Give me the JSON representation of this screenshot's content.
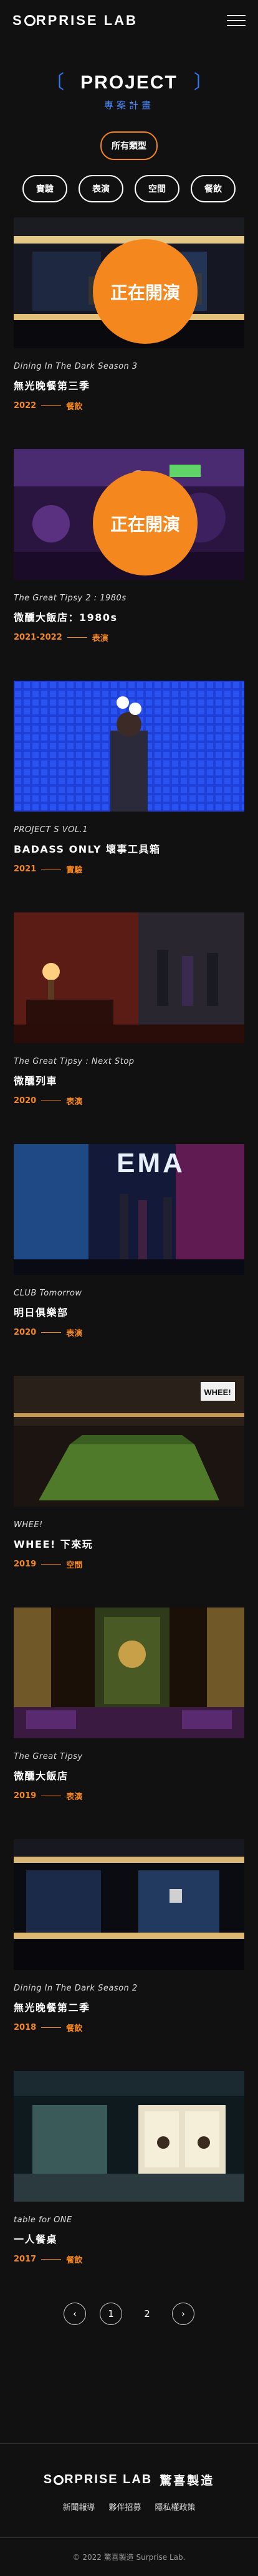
{
  "header": {
    "logo_pre": "S",
    "logo_post": "RPRISE LAB"
  },
  "heading": {
    "title": "PROJECT",
    "subtitle": "專案計畫",
    "bracket_left": "〔",
    "bracket_right": "〕"
  },
  "filters": {
    "all": "所有類型",
    "types": [
      "實驗",
      "表演",
      "空間",
      "餐飲"
    ]
  },
  "projects": [
    {
      "en": "Dining In The Dark Season 3",
      "zh": "無光晚餐第三季",
      "year": "2022",
      "type": "餐飲",
      "badge": "正在開演"
    },
    {
      "en": "The Great Tipsy 2 : 1980s",
      "zh": "微醺大飯店：1980s",
      "year": "2021-2022",
      "type": "表演",
      "badge": "正在開演"
    },
    {
      "en": "PROJECT S VOL.1",
      "zh": "BADASS ONLY 壞事工具箱",
      "year": "2021",
      "type": "實驗"
    },
    {
      "en": "The Great Tipsy : Next Stop",
      "zh": "微醺列車",
      "year": "2020",
      "type": "表演"
    },
    {
      "en": "CLUB Tomorrow",
      "zh": "明日俱樂部",
      "year": "2020",
      "type": "表演",
      "sign": "EMA"
    },
    {
      "en": "WHEE!",
      "zh": "WHEE! 下來玩",
      "year": "2019",
      "type": "空間",
      "sign": "WHEE!"
    },
    {
      "en": "The Great Tipsy",
      "zh": "微醺大飯店",
      "year": "2019",
      "type": "表演"
    },
    {
      "en": "Dining In The Dark Season 2",
      "zh": "無光晚餐第二季",
      "year": "2018",
      "type": "餐飲"
    },
    {
      "en": "table for ONE",
      "zh": "一人餐桌",
      "year": "2017",
      "type": "餐飲"
    }
  ],
  "pagination": {
    "prev": "‹",
    "next": "›",
    "pages": [
      "1",
      "2"
    ],
    "current": "1"
  },
  "footer": {
    "logo_pre": "S",
    "logo_post": "RPRISE LAB",
    "brand_zh": "驚喜製造",
    "links": [
      "新聞報導",
      "夥伴招募",
      "隱私權政策"
    ],
    "copyright": "© 2022 驚喜製造 Surprise Lab."
  },
  "colors": {
    "accent": "#f5871f",
    "blue": "#2f7bff",
    "background": "#111111"
  }
}
